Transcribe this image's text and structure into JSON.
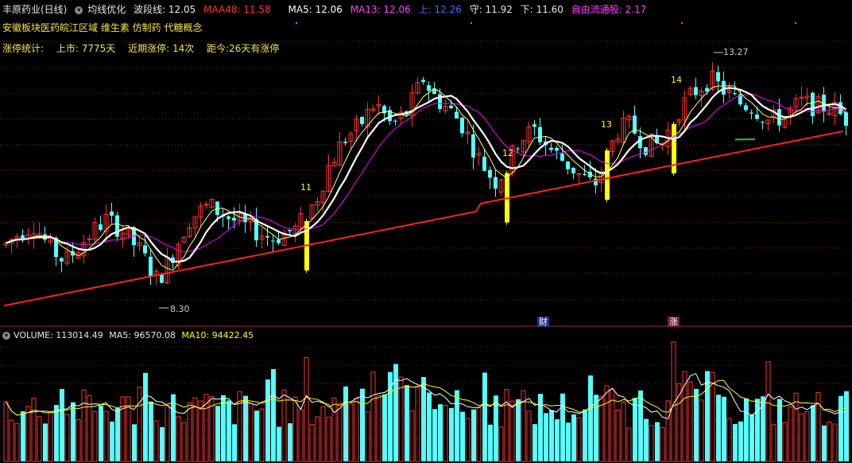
{
  "header": {
    "stock_name": "丰原药业(日线)",
    "indicator_name": "均线优化",
    "wave_line": "波段线: 12.05",
    "maa48": "MAA48: 11.58",
    "ma5": "MA5: 12.06",
    "ma13": "MA13: 12.06",
    "upper": "上: 12.26",
    "guard": "守: 11.92",
    "lower": "下: 11.60",
    "free_float": "自由流通股: 2.17"
  },
  "concepts": "安徽板块医药皖江区域 维生素 仿制药 代糖概念",
  "limit_stats": {
    "label": "涨停统计:",
    "listed": "上市: 7775天",
    "recent": "近期涨停: 14次",
    "since": "距今:26天有涨停"
  },
  "volume_bar": {
    "volume": "VOLUME: 113014.49",
    "ma5": "MA5: 96570.08",
    "ma10": "MA10: 94422.45"
  },
  "annotations": {
    "high_label": "13.27",
    "low_label": "8.30",
    "limit_up_counts": [
      "11",
      "12",
      "13",
      "14"
    ],
    "badge_finance": "财",
    "badge_limit": "涨"
  },
  "colors": {
    "up": "#ff3232",
    "down": "#54ffff",
    "limit_up": "#ffff00",
    "ma_white": "#ffffff",
    "ma_magenta": "#ff00ff",
    "ma_red": "#ff2020",
    "yellow_text": "#f5e742",
    "grid": "#8a1a1a"
  },
  "price_range": [
    7.8,
    13.9
  ],
  "icons": [
    "panel-toggle-icon",
    "volume-panel-toggle-icon"
  ]
}
